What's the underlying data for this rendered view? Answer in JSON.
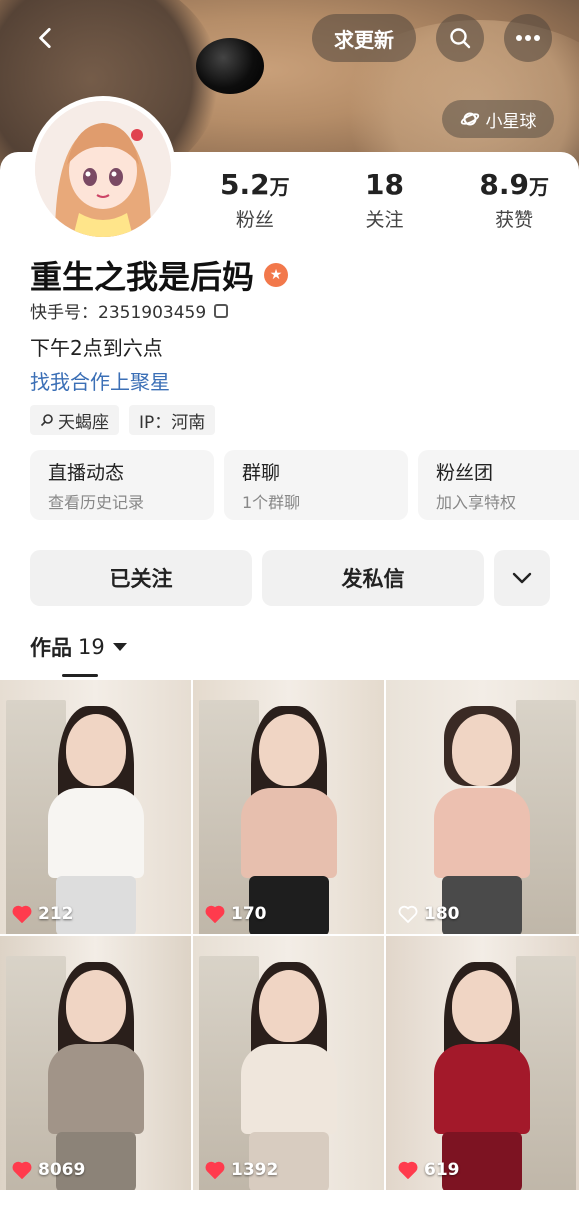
{
  "header": {
    "request_update_label": "求更新",
    "planet_label": "小星球"
  },
  "profile": {
    "stats": [
      {
        "num": "5.2",
        "unit": "万",
        "label": "粉丝"
      },
      {
        "num": "18",
        "unit": "",
        "label": "关注"
      },
      {
        "num": "8.9",
        "unit": "万",
        "label": "获赞"
      }
    ],
    "name": "重生之我是后妈",
    "kuaishou_id": "快手号：2351903459",
    "bio": "下午2点到六点",
    "cooperation_link": "找我合作上聚星",
    "tags": [
      "天蝎座",
      "IP：河南"
    ]
  },
  "features": [
    {
      "title": "直播动态",
      "subtitle": "查看历史记录"
    },
    {
      "title": "群聊",
      "subtitle": "1个群聊"
    },
    {
      "title": "粉丝团",
      "subtitle": "加入享特权"
    }
  ],
  "actions": {
    "follow_label": "已关注",
    "message_label": "发私信"
  },
  "works": {
    "label": "作品",
    "count": "19"
  },
  "videos": [
    {
      "likes": "212",
      "liked": true,
      "hair": "#2a1f1b",
      "top": "#f7f5f2",
      "bottom": "#ddd"
    },
    {
      "likes": "170",
      "liked": true,
      "hair": "#2a1f1b",
      "top": "#e7bfae",
      "bottom": "#1e1e1e"
    },
    {
      "likes": "180",
      "liked": false,
      "hair": "#3a2a24",
      "top": "#ecc0b0",
      "bottom": "#4a4a4a"
    },
    {
      "likes": "8069",
      "liked": true,
      "hair": "#2a1f1b",
      "top": "#a19488",
      "bottom": "#8c8378"
    },
    {
      "likes": "1392",
      "liked": true,
      "hair": "#2a1f1b",
      "top": "#efe6dc",
      "bottom": "#d8ccc0"
    },
    {
      "likes": "619",
      "liked": true,
      "hair": "#2a1f1b",
      "top": "#a3192a",
      "bottom": "#7d1322"
    }
  ],
  "colors": {
    "accent_link": "#3b6fb6",
    "heart_red": "#ff3b4d",
    "badge_orange": "#f2784b"
  }
}
